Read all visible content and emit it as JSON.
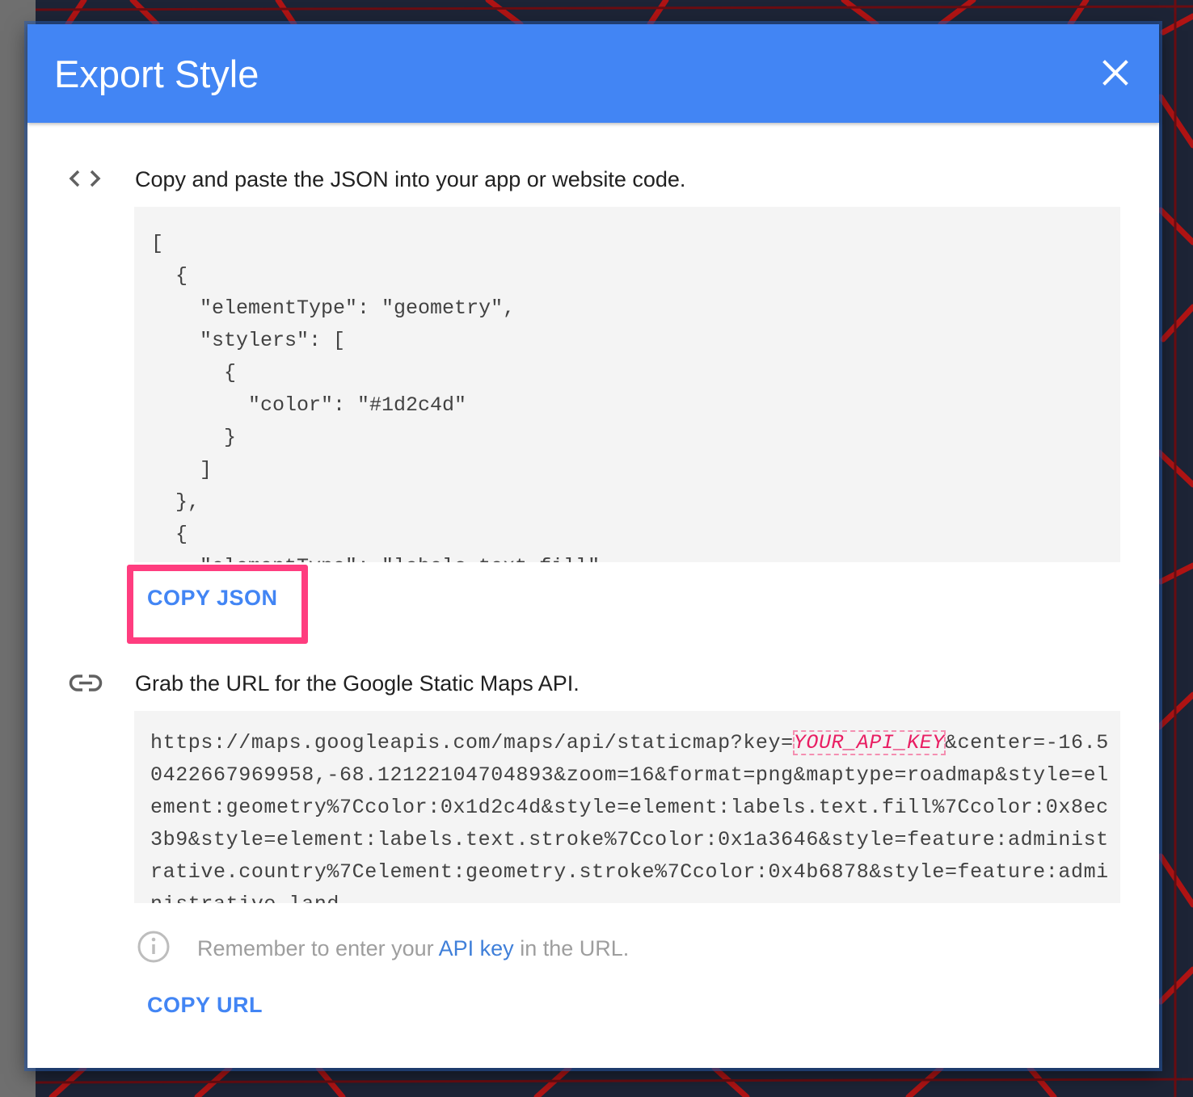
{
  "dialog": {
    "title": "Export Style",
    "close_icon": "close-icon"
  },
  "json_section": {
    "icon": "code-icon",
    "heading": "Copy and paste the JSON into your app or website code.",
    "code": "[\n  {\n    \"elementType\": \"geometry\",\n    \"stylers\": [\n      {\n        \"color\": \"#1d2c4d\"\n      }\n    ]\n  },\n  {\n    \"elementType\": \"labels.text.fill\",",
    "copy_button": "COPY JSON"
  },
  "url_section": {
    "icon": "link-icon",
    "heading": "Grab the URL for the Google Static Maps API.",
    "url_prefix": "https://maps.googleapis.com/maps/api/staticmap?key=",
    "api_key_placeholder": "YOUR_API_KEY",
    "url_suffix": "&center=-16.50422667969958,-68.12122104704893&zoom=16&format=png&maptype=roadmap&style=element:geometry%7Ccolor:0x1d2c4d&style=element:labels.text.fill%7Ccolor:0x8ec3b9&style=element:labels.text.stroke%7Ccolor:0x1a3646&style=feature:administrative.country%7Celement:geometry.stroke%7Ccolor:0x4b6878&style=feature:administrative.land",
    "info_icon": "info-icon",
    "info_before": "Remember to enter your ",
    "info_link": "API key",
    "info_after": " in the URL.",
    "copy_button": "COPY URL"
  },
  "colors": {
    "header": "#4285f4",
    "accent": "#4285f4",
    "highlight": "#ff3d7f",
    "api_key": "#e91e63"
  }
}
